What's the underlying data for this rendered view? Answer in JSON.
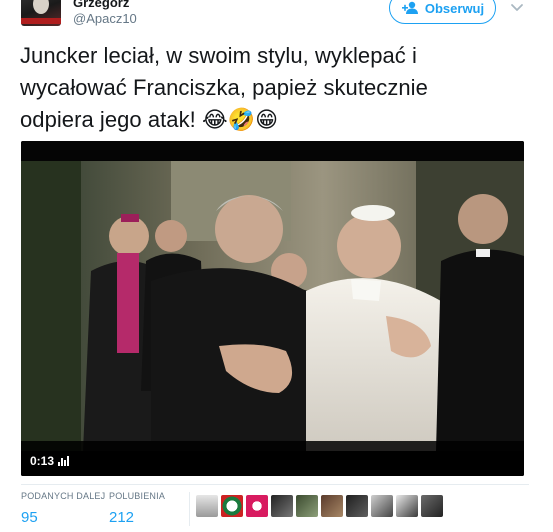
{
  "user": {
    "display_name": "Grzegorz",
    "handle": "@Apacz10"
  },
  "follow_button": {
    "label": "Obserwuj"
  },
  "tweet": {
    "text": "Juncker leciał, w swoim stylu, wyklepać i\nwycałować Franciszka, papież skutecznie\nodpiera jego atak! 😂🤣😁"
  },
  "video": {
    "time": "0:13"
  },
  "stats": {
    "retweets_label": "PODANYCH DALEJ",
    "retweets_value": "95",
    "likes_label": "POLUBIENIA",
    "likes_value": "212"
  },
  "colors": {
    "accent": "#1da1f2",
    "secondary_text": "#657786",
    "primary_text": "#14171a"
  },
  "likers_avatars": [
    "liker-avatar-1",
    "liker-avatar-2",
    "liker-avatar-3",
    "liker-avatar-4",
    "liker-avatar-5",
    "liker-avatar-6",
    "liker-avatar-7",
    "liker-avatar-8",
    "liker-avatar-9",
    "liker-avatar-10"
  ]
}
